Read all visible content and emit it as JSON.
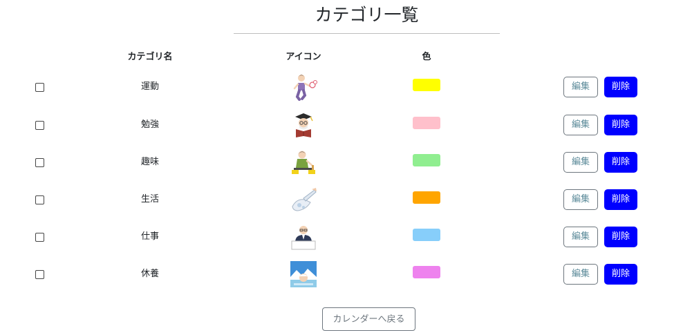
{
  "page": {
    "title": "カテゴリ一覧",
    "back_label": "カレンダーへ戻る"
  },
  "table": {
    "headers": {
      "name": "カテゴリ名",
      "icon": "アイコン",
      "color": "色"
    },
    "rows": [
      {
        "name": "運動",
        "icon": "exercise-icon",
        "color": "#ffff00",
        "checked": false,
        "edit_label": "編集",
        "delete_label": "削除"
      },
      {
        "name": "勉強",
        "icon": "study-icon",
        "color": "#ffc0cb",
        "checked": false,
        "edit_label": "編集",
        "delete_label": "削除"
      },
      {
        "name": "趣味",
        "icon": "hobby-icon",
        "color": "#90ee90",
        "checked": false,
        "edit_label": "編集",
        "delete_label": "削除"
      },
      {
        "name": "生活",
        "icon": "life-icon",
        "color": "#ffa500",
        "checked": false,
        "edit_label": "編集",
        "delete_label": "削除"
      },
      {
        "name": "仕事",
        "icon": "work-icon",
        "color": "#87cefa",
        "checked": false,
        "edit_label": "編集",
        "delete_label": "削除"
      },
      {
        "name": "休養",
        "icon": "rest-icon",
        "color": "#ee82ee",
        "checked": false,
        "edit_label": "編集",
        "delete_label": "削除"
      }
    ]
  }
}
